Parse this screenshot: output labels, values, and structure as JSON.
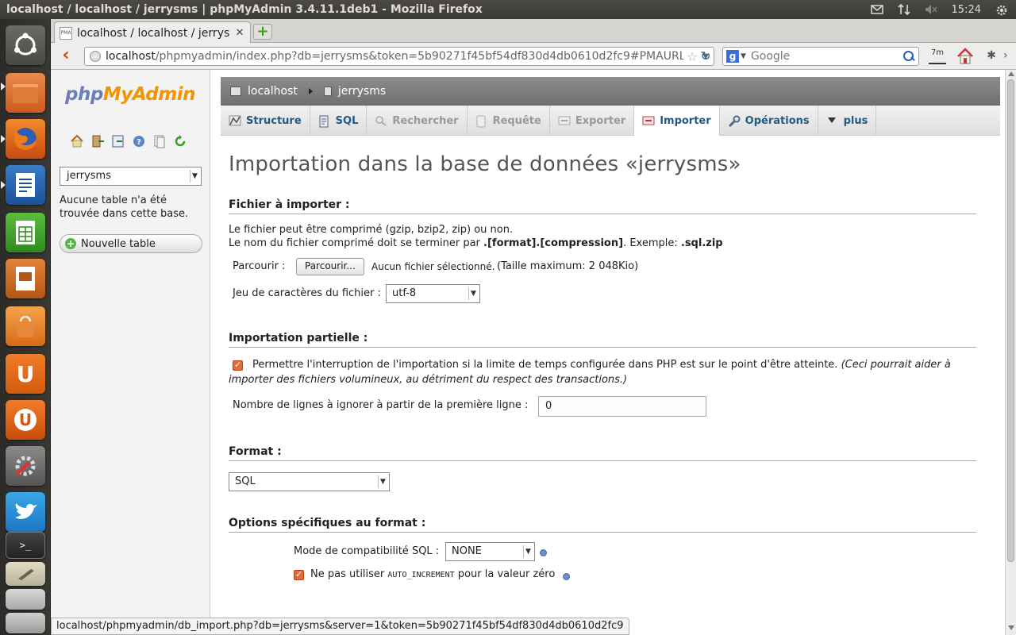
{
  "window": {
    "title": "localhost / localhost / jerrysms | phpMyAdmin 3.4.11.1deb1 - Mozilla Firefox"
  },
  "panel": {
    "clock": "15:24"
  },
  "browser": {
    "tab_label": "localhost / localhost / jerrysm...",
    "url_host": "localhost",
    "url_rest": "/phpmyadmin/index.php?db=jerrysms&token=5b90271f45bf54df830d4db0610d2fc9#PMAURL:",
    "search_placeholder": "Google",
    "badge_7m": "7m",
    "status_url": "localhost/phpmyadmin/db_import.php?db=jerrysms&server=1&token=5b90271f45bf54df830d4db0610d2fc9"
  },
  "sidebar": {
    "logo_php": "php",
    "logo_myadmin": "MyAdmin",
    "db_selected": "jerrysms",
    "no_tables": "Aucune table n'a été trouvée dans cette base.",
    "new_table": "Nouvelle table"
  },
  "breadcrumb": {
    "server": "localhost",
    "database": "jerrysms"
  },
  "tabs": [
    {
      "label": "Structure",
      "state": "normal"
    },
    {
      "label": "SQL",
      "state": "normal"
    },
    {
      "label": "Rechercher",
      "state": "disabled"
    },
    {
      "label": "Requête",
      "state": "disabled"
    },
    {
      "label": "Exporter",
      "state": "disabled"
    },
    {
      "label": "Importer",
      "state": "active"
    },
    {
      "label": "Opérations",
      "state": "normal"
    },
    {
      "label": "plus",
      "state": "normal"
    }
  ],
  "main": {
    "title": "Importation dans la base de données «jerrysms»",
    "file_section": {
      "heading": "Fichier à importer :",
      "line1": "Le fichier peut être comprimé (gzip, bzip2, zip) ou non.",
      "line2_prefix": "Le nom du fichier comprimé doit se terminer par ",
      "line2_bold": ".[format].[compression]",
      "line2_mid": ". Exemple: ",
      "line2_example": ".sql.zip",
      "browse_label": "Parcourir :",
      "browse_button": "Parcourir...",
      "no_file": "Aucun fichier sélectionné.",
      "max_size": "(Taille maximum: 2  048Kio)",
      "charset_label": "Jeu de caractères du fichier :",
      "charset_value": "utf-8"
    },
    "partial_section": {
      "heading": "Importation partielle :",
      "interrupt_text": "Permettre l'interruption de l'importation si la limite de temps configurée dans PHP est sur le point d'être atteinte.",
      "interrupt_note_1": "(Ceci pourrait aider à",
      "interrupt_note_2": "importer des fichiers volumineux, au détriment du respect des transactions.)",
      "skip_label": "Nombre de lignes à ignorer à partir de la première ligne :",
      "skip_value": "0"
    },
    "format_section": {
      "heading": "Format :",
      "value": "SQL"
    },
    "options_section": {
      "heading": "Options spécifiques au format :",
      "compat_label": "Mode de compatibilité SQL :",
      "compat_value": "NONE",
      "auto_inc_prefix": "Ne pas utiliser ",
      "auto_inc_code": "AUTO_INCREMENT",
      "auto_inc_suffix": " pour la valeur zéro"
    }
  },
  "colors": {
    "accent_orange": "#e46a3a",
    "link_blue": "#235a81",
    "breadcrumb_gray": "#7a7a7a"
  }
}
